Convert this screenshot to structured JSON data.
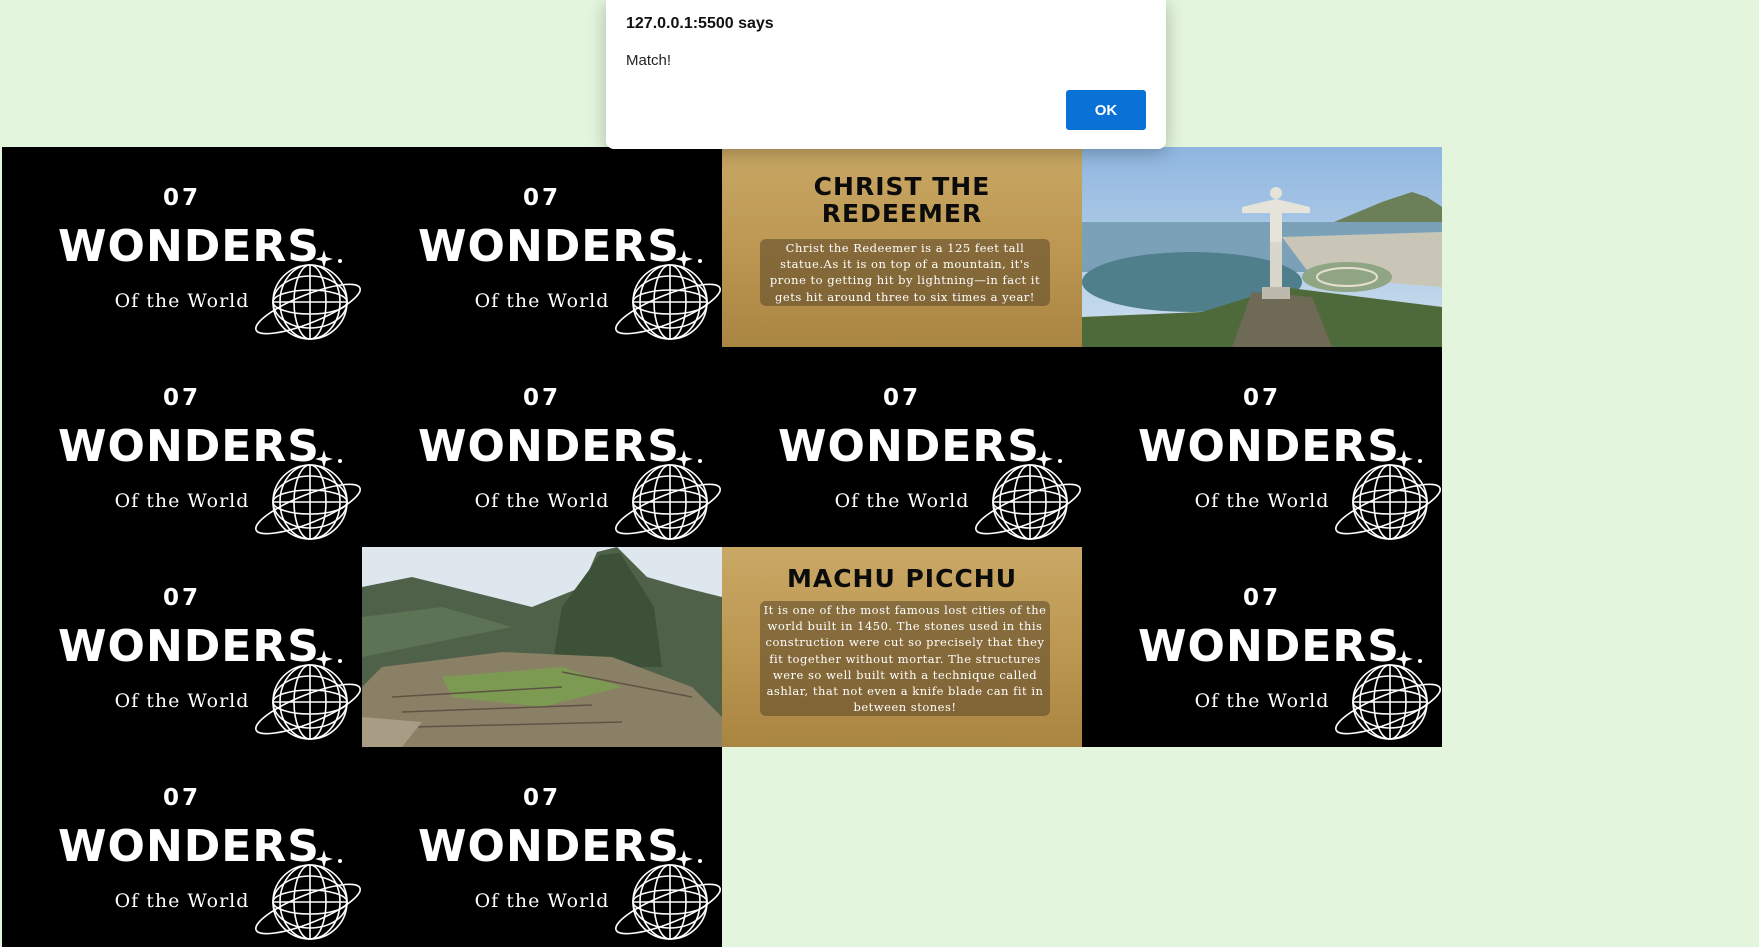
{
  "dialog": {
    "origin": "127.0.0.1:5500 says",
    "message": "Match!",
    "ok_label": "OK"
  },
  "card_back": {
    "number": "07",
    "title": "WONDERS",
    "subtitle": "Of the World"
  },
  "info_cards": {
    "christ": {
      "title_line1": "CHRIST THE",
      "title_line2": "REDEEMER",
      "description": "Christ the Redeemer is a 125 feet tall statue.As it is on top of a mountain, it's prone to getting hit by lightning—in fact it gets hit around three to six times a year!"
    },
    "machu": {
      "title": "MACHU PICCHU",
      "description": "It is one of the most famous lost cities of the world built in 1450.  The stones used in this construction were cut so precisely that they fit together without mortar. The structures were so well built with a technique called ashlar, that not even a knife blade can fit in between stones!"
    }
  },
  "photos": {
    "christ": "christ-the-redeemer-photo",
    "machu": "machu-picchu-photo"
  },
  "colors": {
    "page_bg": "#e3f5dc",
    "card_back_bg": "#000000",
    "info_bg": "#bb9650",
    "ok_button": "#0a72d6"
  }
}
